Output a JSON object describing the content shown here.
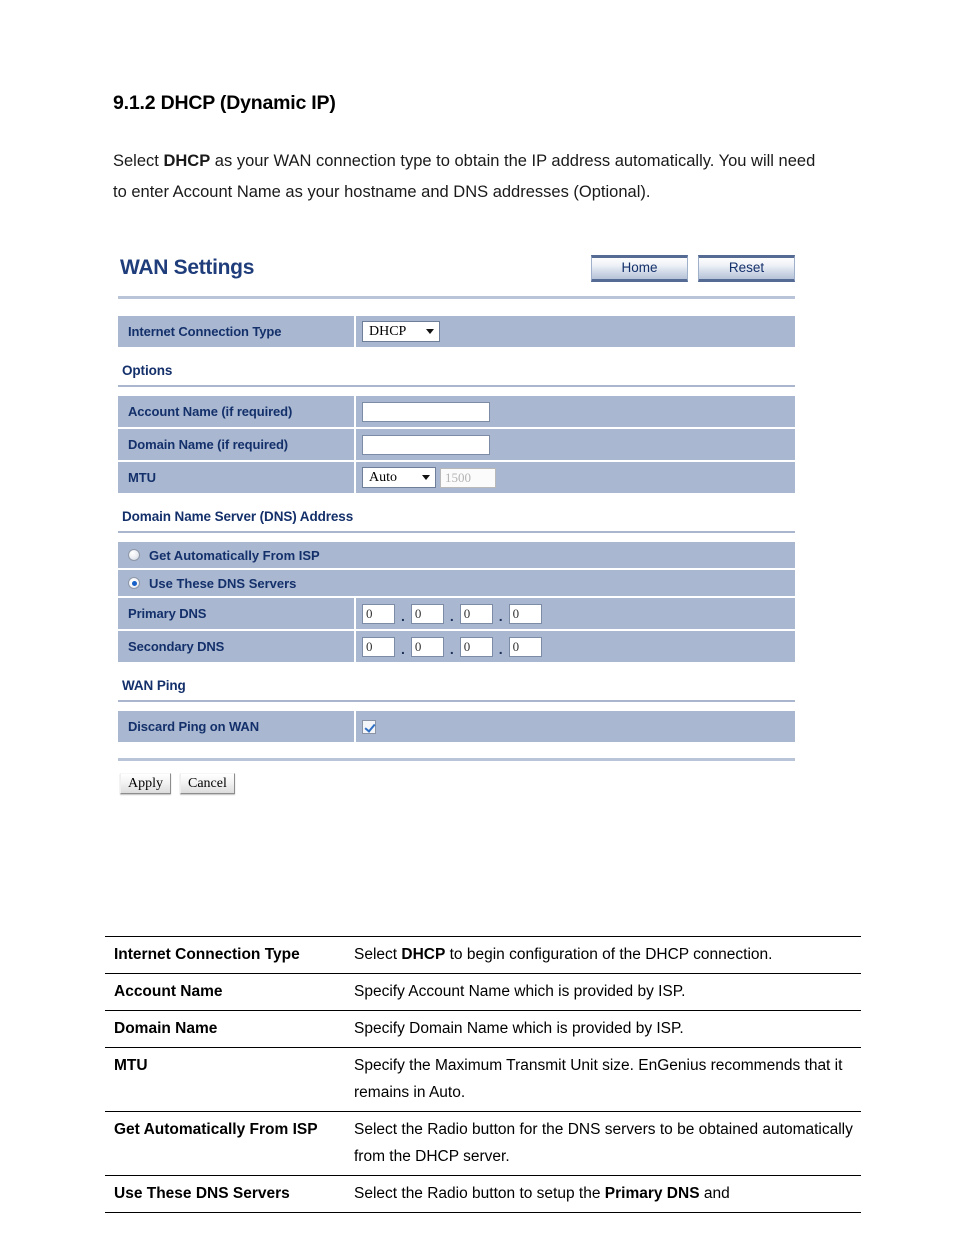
{
  "document": {
    "heading": "9.1.2 DHCP (Dynamic IP)",
    "paragraph_prefix": "Select ",
    "paragraph_bold": "DHCP",
    "paragraph_suffix": " as your WAN connection type to obtain the IP address automatically. You will need to enter Account Name as your hostname and DNS addresses (Optional)."
  },
  "router_ui": {
    "title": "WAN Settings",
    "header_buttons": {
      "home": "Home",
      "reset": "Reset"
    },
    "connection": {
      "label": "Internet Connection Type",
      "selected": "DHCP"
    },
    "options": {
      "section_label": "Options",
      "account_name": {
        "label": "Account Name (if required)",
        "value": ""
      },
      "domain_name": {
        "label": "Domain Name (if required)",
        "value": ""
      },
      "mtu": {
        "label": "MTU",
        "mode": "Auto",
        "size": "1500"
      }
    },
    "dns": {
      "section_label": "Domain Name Server (DNS) Address",
      "auto_option": "Get Automatically From ISP",
      "manual_option": "Use These DNS Servers",
      "selected_option": "Use These DNS Servers",
      "primary": {
        "label": "Primary DNS",
        "octets": [
          "0",
          "0",
          "0",
          "0"
        ]
      },
      "secondary": {
        "label": "Secondary DNS",
        "octets": [
          "0",
          "0",
          "0",
          "0"
        ]
      },
      "separator": "."
    },
    "wan_ping": {
      "section_label": "WAN Ping",
      "discard": {
        "label": "Discard Ping on WAN",
        "checked": true
      }
    },
    "form_buttons": {
      "apply": "Apply",
      "cancel": "Cancel"
    }
  },
  "description_table": {
    "rows": [
      {
        "term": "Internet Connection Type",
        "def_prefix": "Select ",
        "def_bold": "DHCP",
        "def_suffix": " to begin configuration of the DHCP connection."
      },
      {
        "term": "Account Name",
        "def_prefix": "Specify Account Name which is provided by ISP.",
        "def_bold": "",
        "def_suffix": ""
      },
      {
        "term": "Domain Name",
        "def_prefix": "Specify Domain Name which is provided by ISP.",
        "def_bold": "",
        "def_suffix": ""
      },
      {
        "term": "MTU",
        "def_prefix": "Specify the Maximum Transmit Unit size. EnGenius recommends that it remains in Auto.",
        "def_bold": "",
        "def_suffix": ""
      },
      {
        "term": "Get Automatically From ISP",
        "def_prefix": "Select the Radio button for the DNS servers to be obtained automatically from the DHCP server.",
        "def_bold": "",
        "def_suffix": ""
      },
      {
        "term": "Use These DNS Servers",
        "def_prefix": "Select the Radio button to setup the ",
        "def_bold": "Primary DNS",
        "def_suffix": " and"
      }
    ]
  }
}
